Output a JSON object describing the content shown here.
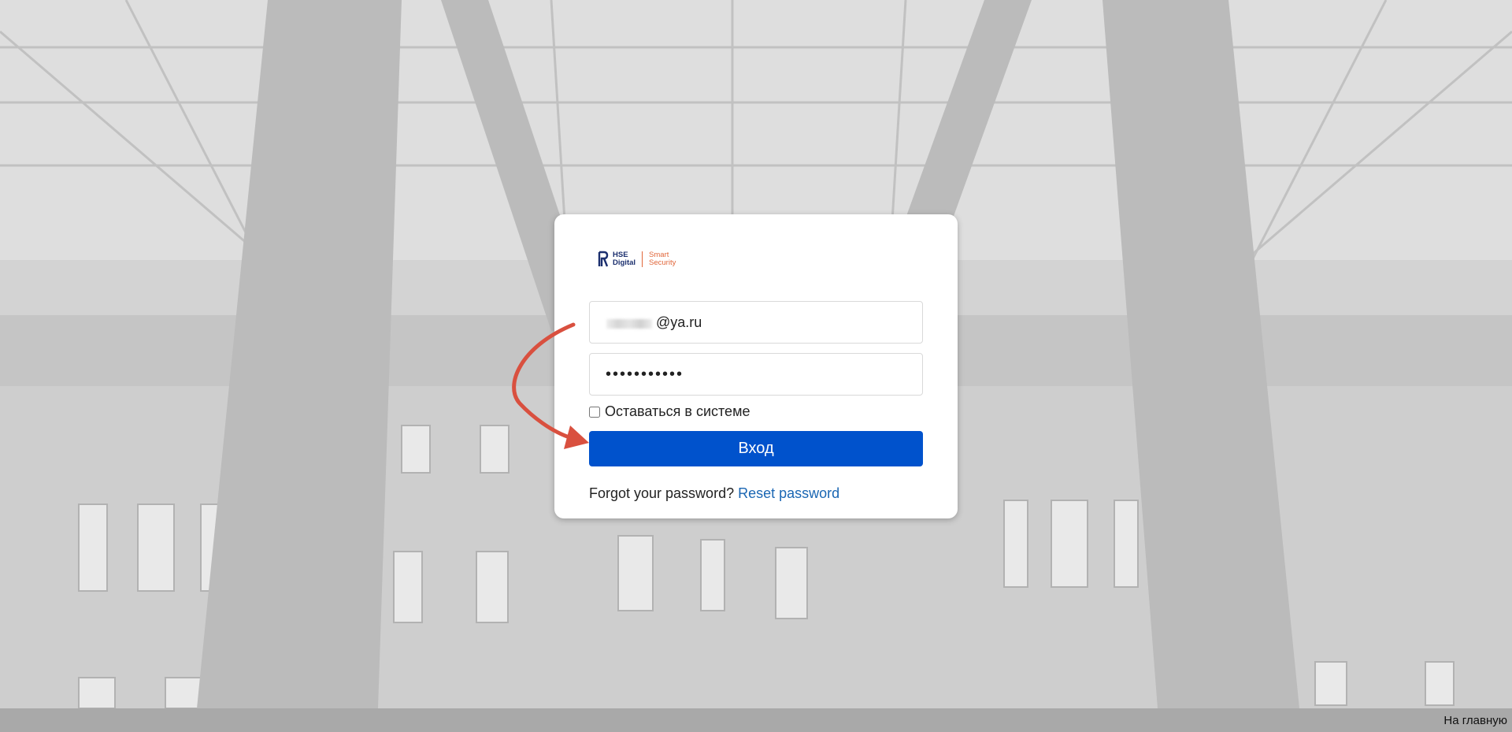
{
  "logo": {
    "left_text": "HSE\nDigital",
    "right_text": "Smart\nSecurity"
  },
  "login_form": {
    "email_value": "@ya.ru",
    "password_value": "•••••••••••",
    "remember_label": "Оставаться в системе",
    "remember_checked": false,
    "submit_label": "Вход",
    "forgot_text": "Forgot your password?",
    "reset_link": "Reset password"
  },
  "footer": {
    "home_link": "На главную"
  },
  "colors": {
    "primary": "#0052cc",
    "link": "#1a66b3",
    "accent": "#e1663a",
    "annotation_arrow": "#d9503f"
  }
}
